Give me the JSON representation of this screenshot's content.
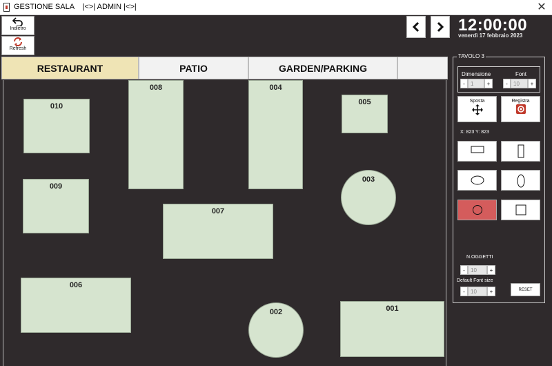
{
  "window": {
    "title": "GESTIONE SALA    |<>| ADMIN |<>|",
    "close_glyph": "✕"
  },
  "sidebar": {
    "back_label": "Indietro",
    "refresh_label": "Refresh"
  },
  "header": {
    "time": "12:00:00",
    "date": "venerdì 17 febbraio 2023"
  },
  "tabs": [
    {
      "label": "RESTAURANT",
      "active": true
    },
    {
      "label": "PATIO",
      "active": false
    },
    {
      "label": "GARDEN/PARKING",
      "active": false
    },
    {
      "label": "",
      "active": false
    }
  ],
  "tables": [
    {
      "label": "010",
      "shape": "rect"
    },
    {
      "label": "008",
      "shape": "rect"
    },
    {
      "label": "004",
      "shape": "rect"
    },
    {
      "label": "005",
      "shape": "rect"
    },
    {
      "label": "009",
      "shape": "rect"
    },
    {
      "label": "003",
      "shape": "circle"
    },
    {
      "label": "007",
      "shape": "rect"
    },
    {
      "label": "006",
      "shape": "rect"
    },
    {
      "label": "002",
      "shape": "circle"
    },
    {
      "label": "001",
      "shape": "rect"
    }
  ],
  "panel": {
    "title": "TAVOLO 3",
    "dimensione_label": "Dimensione",
    "dimensione_value": "1",
    "font_label": "Font",
    "font_value": "10",
    "minus": "-",
    "plus": "+",
    "sposta_label": "Sposta",
    "registra_label": "Registra",
    "coords": "X: 823  Y: 823",
    "n_oggetti_label": "N.OGGETTI",
    "n_oggetti_value": "10",
    "default_font_label": "Default Font size",
    "default_font_value": "10",
    "reset_label": "RESET"
  },
  "colors": {
    "background": "#2f2a2c",
    "table_fill": "#d6e4cf",
    "active_tab": "#efe4b5",
    "selected_shape": "#d45c5c"
  }
}
